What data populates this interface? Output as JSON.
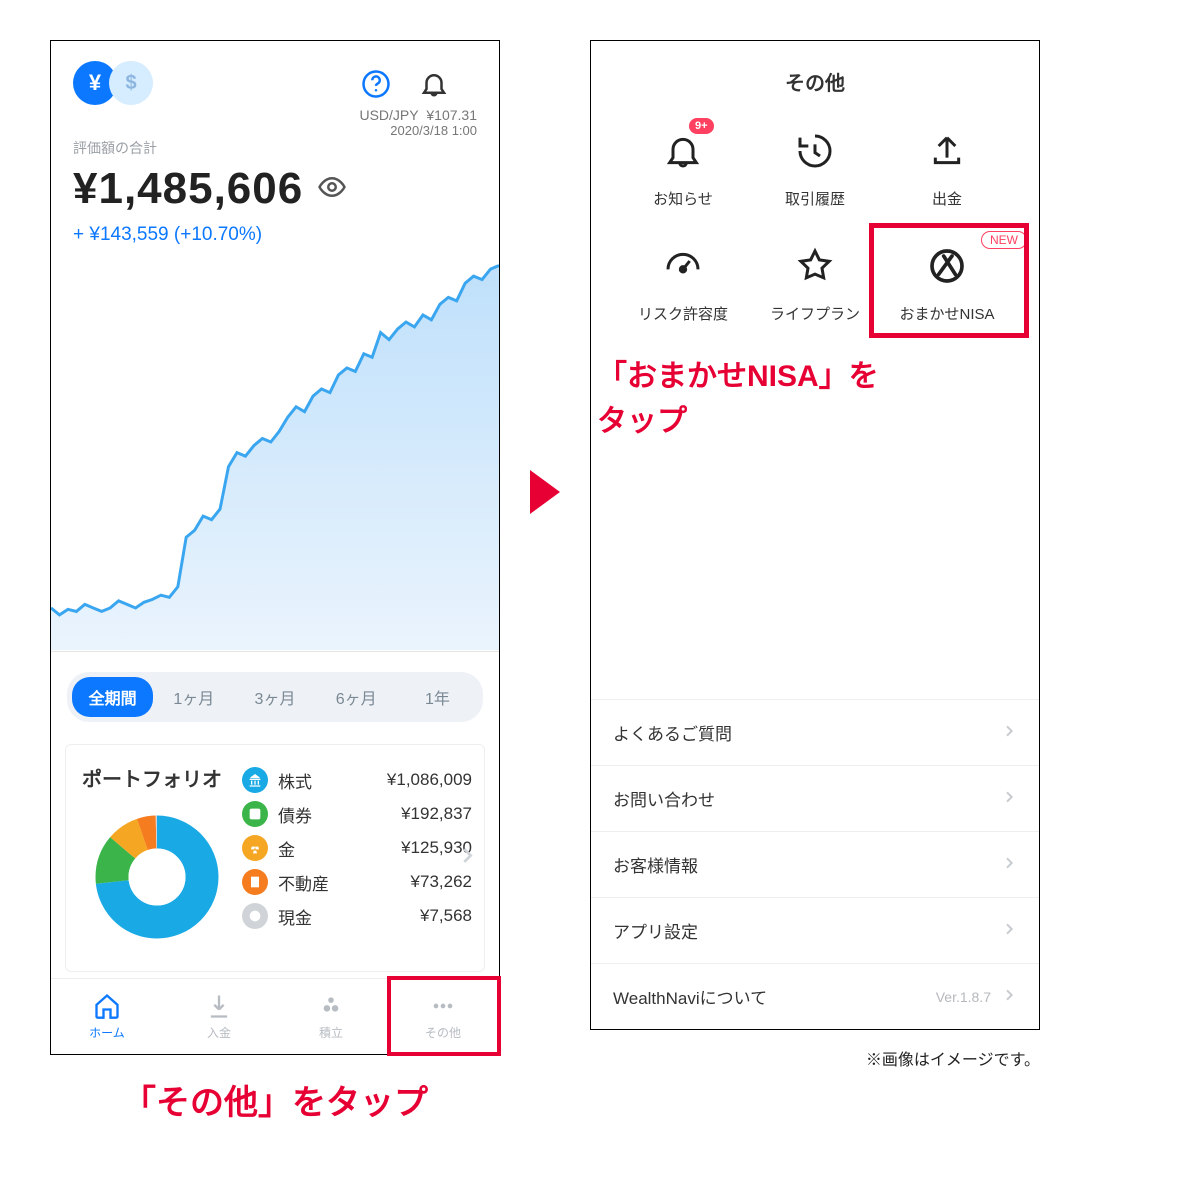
{
  "left": {
    "currency": {
      "yen": "¥",
      "usd": "$"
    },
    "fx": {
      "pair": "USD/JPY",
      "rate": "¥107.31",
      "timestamp": "2020/3/18 1:00"
    },
    "eval_label": "評価額の合計",
    "balance": "¥1,485,606",
    "gain": "+ ¥143,559  (+10.70%)",
    "ranges": [
      "全期間",
      "1ヶ月",
      "3ヶ月",
      "6ヶ月",
      "1年"
    ],
    "portfolio_title": "ポートフォリオ",
    "assets": [
      {
        "name": "株式",
        "value": "¥1,086,009",
        "color": "#19a9e5"
      },
      {
        "name": "債券",
        "value": "¥192,837",
        "color": "#3bb54a"
      },
      {
        "name": "金",
        "value": "¥125,930",
        "color": "#f5a623"
      },
      {
        "name": "不動産",
        "value": "¥73,262",
        "color": "#f57c1f"
      },
      {
        "name": "現金",
        "value": "¥7,568",
        "color": "#d0d4d8"
      }
    ],
    "tabs": [
      "ホーム",
      "入金",
      "積立",
      "その他"
    ]
  },
  "right": {
    "title": "その他",
    "grid": [
      {
        "label": "お知らせ",
        "badge": "9+"
      },
      {
        "label": "取引履歴"
      },
      {
        "label": "出金"
      },
      {
        "label": "リスク許容度"
      },
      {
        "label": "ライフプラン"
      },
      {
        "label": "おまかせNISA",
        "new": "NEW",
        "highlight": true
      }
    ],
    "menu": [
      {
        "label": "よくあるご質問"
      },
      {
        "label": "お問い合わせ"
      },
      {
        "label": "お客様情報"
      },
      {
        "label": "アプリ設定"
      },
      {
        "label": "WealthNaviについて",
        "meta": "Ver.1.8.7"
      }
    ]
  },
  "captions": {
    "left": "「その他」をタップ",
    "right": "「おまかせNISA」を\nタップ",
    "disclaimer": "※画像はイメージです。"
  },
  "chart_data": {
    "type": "area",
    "xrange_label": "全期間",
    "y_unit": "JPY",
    "series": [
      {
        "name": "評価額",
        "values": [
          1060000,
          1050000,
          1058000,
          1055000,
          1065000,
          1060000,
          1055000,
          1060000,
          1070000,
          1065000,
          1060000,
          1068000,
          1072000,
          1078000,
          1075000,
          1090000,
          1160000,
          1170000,
          1190000,
          1185000,
          1200000,
          1260000,
          1280000,
          1275000,
          1290000,
          1300000,
          1295000,
          1310000,
          1330000,
          1345000,
          1338000,
          1360000,
          1370000,
          1365000,
          1390000,
          1400000,
          1395000,
          1420000,
          1415000,
          1450000,
          1440000,
          1455000,
          1465000,
          1458000,
          1475000,
          1468000,
          1490000,
          1500000,
          1495000,
          1520000,
          1530000,
          1525000,
          1540000,
          1545000
        ]
      }
    ],
    "ylim": [
      1000000,
      1550000
    ]
  }
}
